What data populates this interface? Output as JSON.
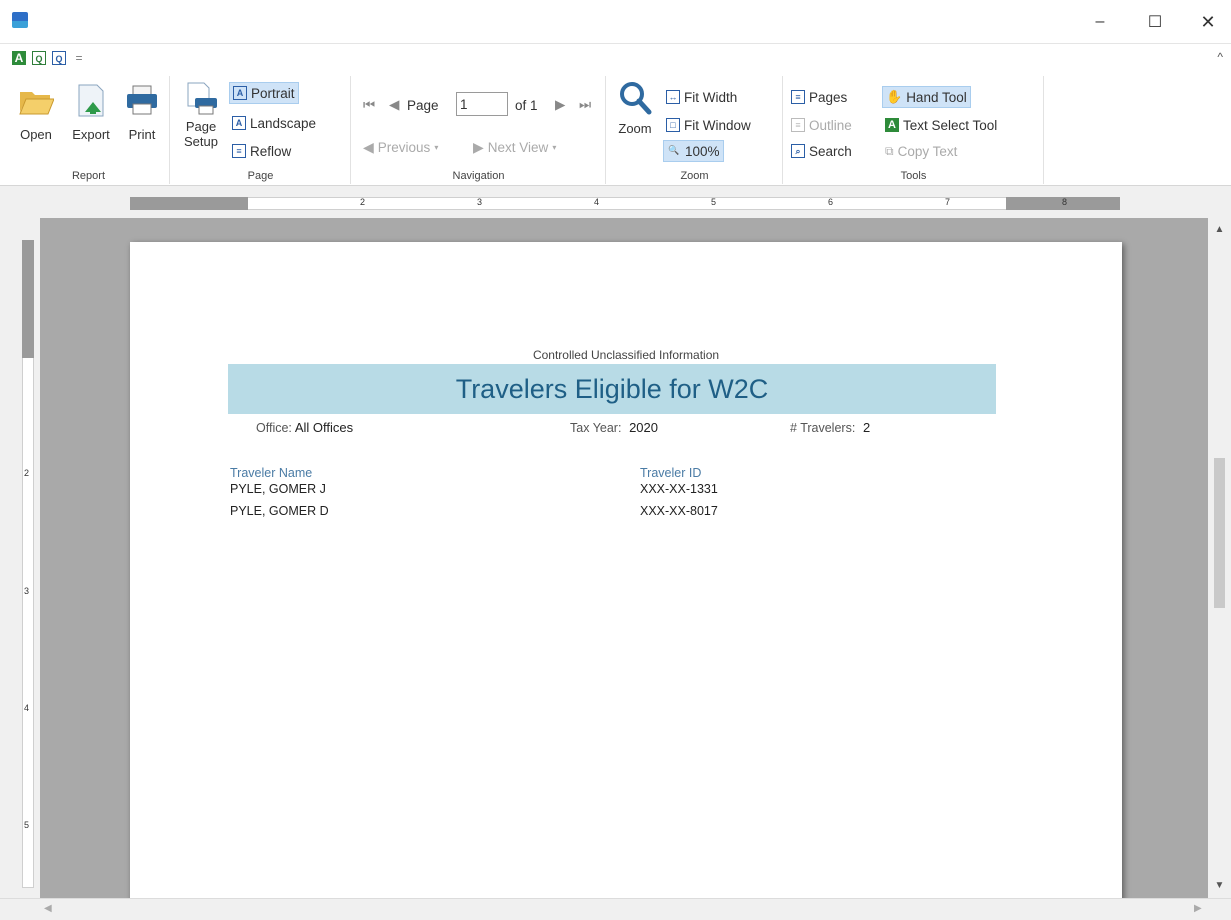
{
  "window": {
    "minimize": "–",
    "maximize": "☐",
    "close": "✕"
  },
  "qat": {
    "collapse": "^",
    "more": "="
  },
  "ribbon": {
    "report": {
      "label": "Report",
      "open": "Open",
      "export": "Export",
      "print": "Print"
    },
    "page": {
      "label": "Page",
      "page_setup_line1": "Page",
      "page_setup_line2": "Setup",
      "portrait": "Portrait",
      "landscape": "Landscape",
      "reflow": "Reflow"
    },
    "navigation": {
      "label": "Navigation",
      "page_prefix": "Page",
      "page_value": "1",
      "page_suffix": "of 1",
      "previous": "Previous",
      "next_view": "Next View"
    },
    "zoom": {
      "label": "Zoom",
      "zoom": "Zoom",
      "fit_width": "Fit Width",
      "fit_window": "Fit Window",
      "hundred": "100%"
    },
    "tools": {
      "label": "Tools",
      "pages": "Pages",
      "outline": "Outline",
      "search": "Search",
      "hand_tool": "Hand Tool",
      "text_select_tool": "Text Select Tool",
      "copy_text": "Copy Text"
    }
  },
  "ruler": {
    "h_numbers": [
      "2",
      "3",
      "4",
      "5",
      "6",
      "7",
      "8"
    ],
    "v_numbers": [
      "2",
      "3",
      "4",
      "5"
    ]
  },
  "report": {
    "classification": "Controlled Unclassified Information",
    "title": "Travelers Eligible for W2C",
    "office_label": "Office:",
    "office_value": "All Offices",
    "tax_year_label": "Tax Year:",
    "tax_year_value": "2020",
    "travelers_label": "# Travelers:",
    "travelers_value": "2",
    "columns": [
      "Traveler Name",
      "Traveler ID"
    ],
    "rows": [
      [
        "PYLE, GOMER J",
        "XXX-XX-1331"
      ],
      [
        "PYLE, GOMER D",
        "XXX-XX-8017"
      ]
    ]
  },
  "colors": {
    "banner_bg": "#b8dbe6",
    "banner_text": "#1f5f86",
    "selected_bg": "#cfe3f7",
    "viewport_bg": "#a9a9a9"
  }
}
